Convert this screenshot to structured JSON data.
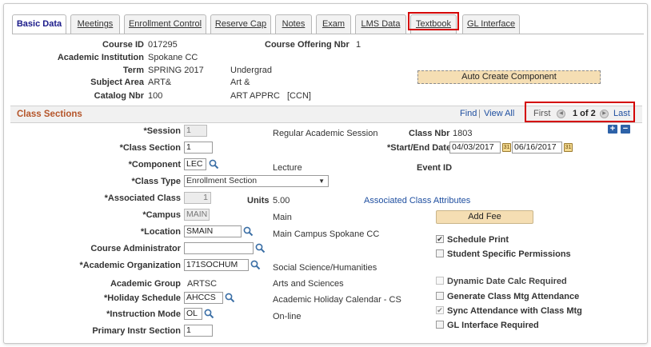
{
  "tabs": [
    {
      "label": "Basic Data",
      "active": true
    },
    {
      "label": "Meetings",
      "active": false
    },
    {
      "label": "Enrollment Control",
      "active": false
    },
    {
      "label": "Reserve Cap",
      "active": false
    },
    {
      "label": "Notes",
      "active": false
    },
    {
      "label": "Exam",
      "active": false
    },
    {
      "label": "LMS Data",
      "active": false
    },
    {
      "label": "Textbook",
      "active": false
    },
    {
      "label": "GL Interface",
      "active": false
    }
  ],
  "course": {
    "course_id_label": "Course ID",
    "course_id": "017295",
    "offering_nbr_label": "Course Offering Nbr",
    "offering_nbr": "1",
    "institution_label": "Academic Institution",
    "institution": "Spokane CC",
    "term_label": "Term",
    "term": "SPRING 2017",
    "term_career": "Undergrad",
    "subject_label": "Subject Area",
    "subject": "ART&",
    "subject_desc": "Art &",
    "catalog_label": "Catalog Nbr",
    "catalog": "100",
    "catalog_desc": "ART APPRC",
    "catalog_ccn": "[CCN]",
    "auto_create_button": "Auto Create Component"
  },
  "section_header": {
    "title": "Class Sections",
    "find": "Find",
    "sep": "|",
    "view_all": "View All",
    "first": "First",
    "position": "1 of 2",
    "last": "Last"
  },
  "form": {
    "session_label": "*Session",
    "session": "1",
    "session_desc": "Regular Academic Session",
    "class_nbr_label": "Class Nbr",
    "class_nbr": "1803",
    "class_section_label": "*Class Section",
    "class_section": "1",
    "start_end_label": "*Start/End Date",
    "start_date": "04/03/2017",
    "end_date": "06/16/2017",
    "component_label": "*Component",
    "component": "LEC",
    "component_desc": "Lecture",
    "event_id_label": "Event ID",
    "class_type_label": "*Class Type",
    "class_type": "Enrollment Section",
    "assoc_class_label": "*Associated Class",
    "assoc_class": "1",
    "units_label": "Units",
    "units": "5.00",
    "assoc_attr_link": "Associated Class Attributes",
    "campus_label": "*Campus",
    "campus": "MAIN",
    "campus_desc": "Main",
    "add_fee_button": "Add Fee",
    "location_label": "*Location",
    "location": "SMAIN",
    "location_desc": "Main Campus Spokane CC",
    "course_admin_label": "Course Administrator",
    "course_admin": "",
    "acad_org_label": "*Academic Organization",
    "acad_org": "171SOCHUM",
    "acad_org_desc": "Social Science/Humanities",
    "acad_group_label": "Academic Group",
    "acad_group": "ARTSC",
    "acad_group_desc": "Arts and Sciences",
    "holiday_label": "*Holiday Schedule",
    "holiday": "AHCCS",
    "holiday_desc": "Academic Holiday Calendar - CS",
    "instr_mode_label": "*Instruction Mode",
    "instr_mode": "OL",
    "instr_mode_desc": "On-line",
    "primary_instr_label": "Primary Instr Section",
    "primary_instr": "1"
  },
  "checkboxes": {
    "schedule_print": "Schedule Print",
    "student_specific": "Student Specific Permissions",
    "dynamic_date": "Dynamic Date Calc Required",
    "gen_class_mtg": "Generate Class Mtg Attendance",
    "sync_attendance": "Sync Attendance with Class Mtg",
    "gl_interface": "GL Interface Required"
  },
  "colors": {
    "highlight": "#d40000",
    "section_title": "#b5552a",
    "link": "#1f4fa0",
    "button_tan": "#f5deb3"
  }
}
